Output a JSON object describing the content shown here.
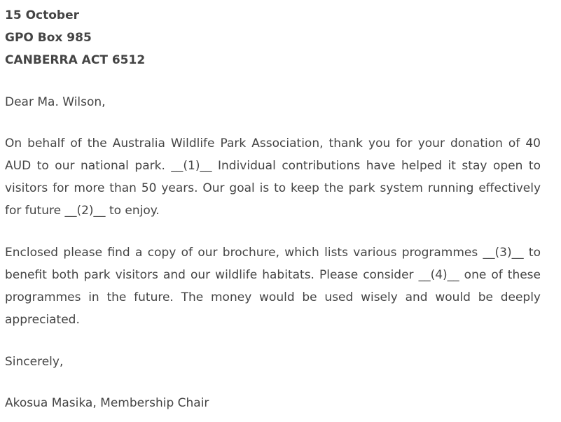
{
  "header": {
    "date": "15 October",
    "address_line1": "GPO Box 985",
    "address_line2": "CANBERRA ACT 6512"
  },
  "salutation": "Dear Ma. Wilson,",
  "paragraphs": [
    "On behalf of the Australia Wildlife Park Association, thank you for your donation of 40 AUD to our national park. __(1)__ Individual contributions have helped it stay open to visitors for more than 50 years. Our goal is to keep the park system running effectively for future __(2)__ to enjoy.",
    "Enclosed please find a copy of our brochure, which lists various programmes __(3)__ to benefit both park visitors and our wildlife habitats. Please consider __(4)__ one of these programmes in the future. The money would be used wisely and would be deeply appreciated."
  ],
  "closing": "Sincerely,",
  "signature": "Akosua Masika, Membership Chair"
}
